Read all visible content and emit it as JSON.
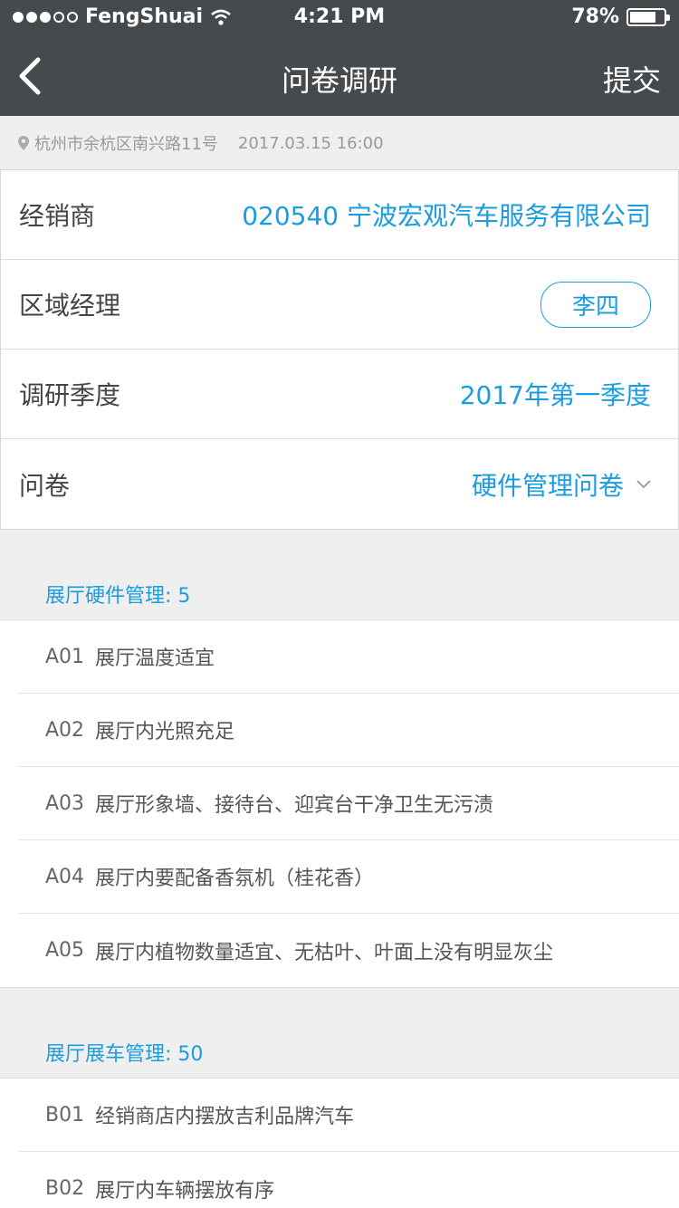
{
  "status_bar": {
    "carrier": "FengShuai",
    "time": "4:21 PM",
    "battery": "78%",
    "battery_level": 0.78,
    "signal_bars_filled": 3,
    "signal_bars_total": 5
  },
  "nav": {
    "title": "问卷调研",
    "submit_label": "提交"
  },
  "location": {
    "address": "杭州市余杭区南兴路11号",
    "datetime": "2017.03.15  16:00"
  },
  "form": {
    "dealer_label": "经销商",
    "dealer_value": "020540 宁波宏观汽车服务有限公司",
    "manager_label": "区域经理",
    "manager_value": "李四",
    "quarter_label": "调研季度",
    "quarter_value": "2017年第一季度",
    "questionnaire_label": "问卷",
    "questionnaire_value": "硬件管理问卷"
  },
  "sections": [
    {
      "header": "展厅硬件管理: 5",
      "items": [
        {
          "code": "A01",
          "text": "展厅温度适宜"
        },
        {
          "code": "A02",
          "text": "展厅内光照充足"
        },
        {
          "code": "A03",
          "text": "展厅形象墙、接待台、迎宾台干净卫生无污渍"
        },
        {
          "code": "A04",
          "text": "展厅内要配备香氛机（桂花香）"
        },
        {
          "code": "A05",
          "text": "展厅内植物数量适宜、无枯叶、叶面上没有明显灰尘"
        }
      ]
    },
    {
      "header": "展厅展车管理: 50",
      "items": [
        {
          "code": "B01",
          "text": "经销商店内摆放吉利品牌汽车"
        },
        {
          "code": "B02",
          "text": "展厅内车辆摆放有序"
        }
      ]
    }
  ],
  "colors": {
    "header_bg": "#464a4c",
    "accent": "#1a9ce0",
    "page_bg": "#efefef"
  }
}
